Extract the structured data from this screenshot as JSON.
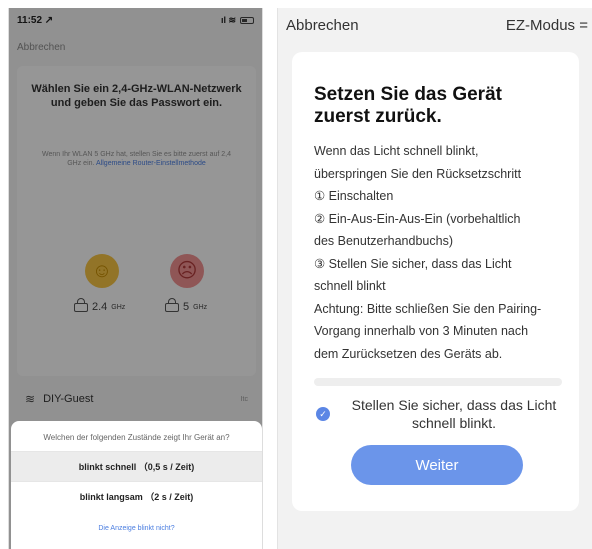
{
  "left_screen": {
    "status": {
      "time": "11:52 ↗",
      "icons": "ıl ≋"
    },
    "cancel_label": "Abbrechen",
    "wifi_prompt": {
      "title": "Wählen Sie ein 2,4-GHz-WLAN-Netzwerk und geben Sie das Passwort ein.",
      "hint": "Wenn Ihr WLAN 5 GHz hat, stellen Sie es bitte zuerst auf 2,4 GHz ein.",
      "hint_link": "Allgemeine Router-Einstellmethode",
      "happy_face": "☺",
      "sad_face": "☹",
      "band_24": "2.4",
      "band_24_unit": "GHz",
      "band_5": "5",
      "band_5_unit": "GHz"
    },
    "network": {
      "wifi_glyph": "≋",
      "ssid": "DIY-Guest",
      "right_hint": "Itc"
    },
    "sheet": {
      "question": "Welchen der folgenden Zustände zeigt Ihr Gerät an?",
      "option_fast": "blinkt schnell （0,5 s / Zeit)",
      "option_slow": "blinkt langsam （2 s / Zeit)",
      "link": "Die Anzeige blinkt nicht?"
    }
  },
  "right_screen": {
    "nav": {
      "cancel": "Abbrechen",
      "mode": "EZ-Modus ="
    },
    "title": "Setzen Sie das Gerät zuerst zurück.",
    "instructions": [
      "Wenn das Licht schnell blinkt,",
      "überspringen Sie den Rücksetzschritt",
      "① Einschalten",
      "② Ein-Aus-Ein-Aus-Ein (vorbehaltlich",
      "des Benutzerhandbuchs)",
      "③ Stellen Sie sicher, dass das Licht",
      "schnell blinkt",
      "Achtung: Bitte schließen Sie den Pairing-",
      "Vorgang innerhalb von 3 Minuten nach",
      "dem Zurücksetzen des Geräts ab."
    ],
    "confirm_check": "✓",
    "confirm_text": "Stellen Sie sicher, dass das Licht schnell blinkt.",
    "button_label": "Weiter"
  },
  "colors": {
    "accent": "#6b95ea",
    "link": "#4a7de0"
  }
}
